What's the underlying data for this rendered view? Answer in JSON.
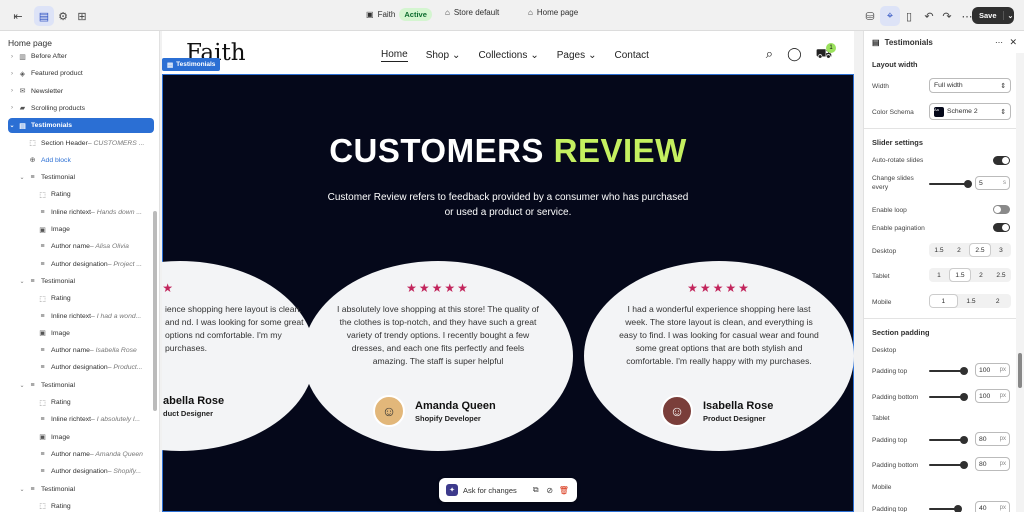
{
  "topbar": {
    "theme_name": "Faith",
    "theme_status": "Active",
    "store": "Store default",
    "page": "Home page",
    "save_label": "Save"
  },
  "left_panel": {
    "title": "Home page",
    "items": [
      {
        "label": "Before After",
        "detail": "",
        "icon": "image-compare-icon"
      },
      {
        "label": "Featured product",
        "detail": "",
        "icon": "tag-icon"
      },
      {
        "label": "Newsletter",
        "detail": "",
        "icon": "mail-icon"
      },
      {
        "label": "Scrolling products",
        "detail": "",
        "icon": "shop-bag-icon"
      },
      {
        "label": "Testimonials",
        "detail": "",
        "icon": "list-icon"
      },
      {
        "label": "Section Header",
        "detail": " – CUSTOMERS ...",
        "icon": "dashed-box-icon"
      },
      {
        "label": "Add block",
        "detail": "",
        "icon": "plus-circle-icon"
      },
      {
        "label": "Testimonial",
        "detail": "",
        "icon": "text-lines-icon"
      },
      {
        "label": "Rating",
        "detail": "",
        "icon": "dashed-box-icon"
      },
      {
        "label": "Inline richtext",
        "detail": " – Hands down ...",
        "icon": "text-lines-icon"
      },
      {
        "label": "Image",
        "detail": "",
        "icon": "image-icon"
      },
      {
        "label": "Author name",
        "detail": " – Alisa Olivia",
        "icon": "text-lines-icon"
      },
      {
        "label": "Author designation",
        "detail": " – Project ...",
        "icon": "text-lines-icon"
      },
      {
        "label": "Testimonial",
        "detail": "",
        "icon": "text-lines-icon"
      },
      {
        "label": "Rating",
        "detail": "",
        "icon": "dashed-box-icon"
      },
      {
        "label": "Inline richtext",
        "detail": " – I had a wond...",
        "icon": "text-lines-icon"
      },
      {
        "label": "Image",
        "detail": "",
        "icon": "image-icon"
      },
      {
        "label": "Author name",
        "detail": " – Isabella Rose",
        "icon": "text-lines-icon"
      },
      {
        "label": "Author designation",
        "detail": " – Product...",
        "icon": "text-lines-icon"
      },
      {
        "label": "Testimonial",
        "detail": "",
        "icon": "text-lines-icon"
      },
      {
        "label": "Rating",
        "detail": "",
        "icon": "dashed-box-icon"
      },
      {
        "label": "Inline richtext",
        "detail": " – I absolutely l...",
        "icon": "text-lines-icon"
      },
      {
        "label": "Image",
        "detail": "",
        "icon": "image-icon"
      },
      {
        "label": "Author name",
        "detail": " – Amanda Queen",
        "icon": "text-lines-icon"
      },
      {
        "label": "Author designation",
        "detail": " – Shopify...",
        "icon": "text-lines-icon"
      },
      {
        "label": "Testimonial",
        "detail": "",
        "icon": "text-lines-icon"
      },
      {
        "label": "Rating",
        "detail": "",
        "icon": "dashed-box-icon"
      }
    ]
  },
  "store": {
    "logo": "Faith",
    "nav": [
      "Home",
      "Shop",
      "Collections",
      "Pages",
      "Contact"
    ],
    "cart_count": "1",
    "section_tag": "Testimonials"
  },
  "testimonials": {
    "title_main": "CUSTOMERS ",
    "title_highlight": "REVIEW",
    "subtitle": "Customer Review refers to feedback provided by a consumer who has purchased or used a product or service.",
    "stars": "★★★★★",
    "partial_stars": "★★",
    "cards": [
      {
        "quote": "ience shopping here layout is clean, and nd. I was looking for some great options nd comfortable. I'm my purchases.",
        "name": "abella Rose",
        "role": "duct Designer"
      },
      {
        "quote": "I absolutely love shopping at this store! The quality of the clothes is top-notch, and they have such a great variety of trendy options. I recently bought a few dresses, and each one fits perfectly and feels amazing. The staff is super helpful",
        "name": "Amanda Queen",
        "role": "Shopify Developer"
      },
      {
        "quote": "I had a wonderful experience shopping here last week. The store layout is clean, and everything is easy to find. I was looking for casual wear and found some great options that are both stylish and comfortable. I'm really happy with my purchases.",
        "name": "Isabella Rose",
        "role": "Product Designer"
      }
    ]
  },
  "ask_bar": {
    "label": "Ask for changes"
  },
  "right_panel": {
    "title": "Testimonials",
    "layout_width": "Layout width",
    "width_label": "Width",
    "width_value": "Full width",
    "color_schema_label": "Color Schema",
    "color_schema_value": "Scheme 2",
    "slider_settings": "Slider settings",
    "auto_rotate": "Auto-rotate slides",
    "change_slides": "Change slides every",
    "change_value": "5",
    "change_unit": "s",
    "enable_loop": "Enable loop",
    "enable_pagination": "Enable pagination",
    "desktop": "Desktop",
    "desktop_opts": [
      "1.5",
      "2",
      "2.5",
      "3"
    ],
    "tablet": "Tablet",
    "tablet_opts": [
      "1",
      "1.5",
      "2",
      "2.5"
    ],
    "mobile": "Mobile",
    "mobile_opts": [
      "1",
      "1.5",
      "2"
    ],
    "section_padding": "Section padding",
    "desktop_sub": "Desktop",
    "padding_top": "Padding top",
    "padding_bottom": "Padding bottom",
    "d_top": "100",
    "d_bottom": "100",
    "tablet_sub": "Tablet",
    "t_top": "80",
    "t_bottom": "80",
    "mobile_sub": "Mobile",
    "m_top": "40",
    "unit_px": "px"
  }
}
